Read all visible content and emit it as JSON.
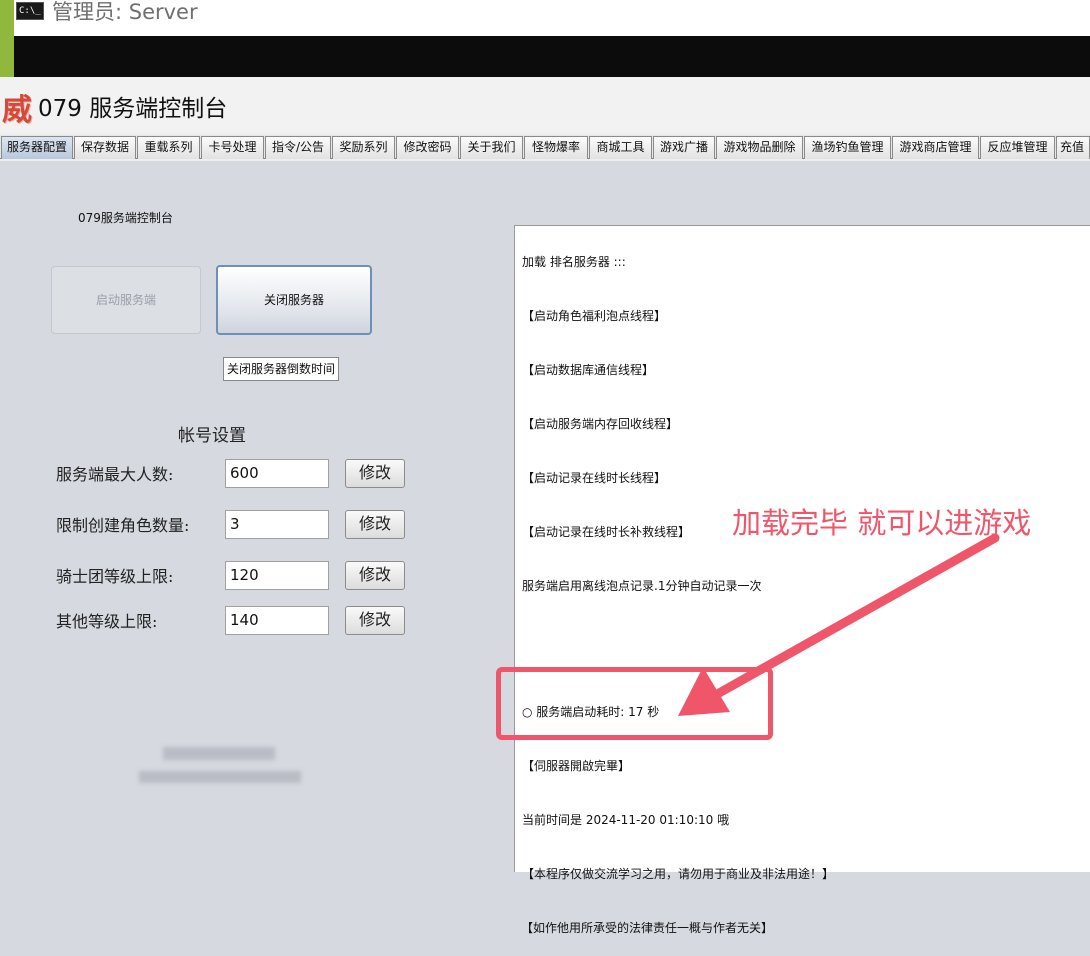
{
  "console": {
    "icon_text": "C:\\_",
    "title": "管理员:  Server"
  },
  "app": {
    "logo": "威",
    "title": "079 服务端控制台"
  },
  "tabs": [
    {
      "label": "服务器配置",
      "active": true
    },
    {
      "label": "保存数据"
    },
    {
      "label": "重载系列"
    },
    {
      "label": "卡号处理"
    },
    {
      "label": "指令/公告"
    },
    {
      "label": "奖励系列"
    },
    {
      "label": "修改密码"
    },
    {
      "label": "关于我们"
    },
    {
      "label": "怪物爆率"
    },
    {
      "label": "商城工具"
    },
    {
      "label": "游戏广播"
    },
    {
      "label": "游戏物品删除"
    },
    {
      "label": "渔场钓鱼管理"
    },
    {
      "label": "游戏商店管理"
    },
    {
      "label": "反应堆管理"
    },
    {
      "label": "充值"
    }
  ],
  "left": {
    "server_label": "079服务端控制台",
    "start_button": "启动服务端",
    "stop_button": "关闭服务器",
    "countdown_value": "关闭服务器倒数时间",
    "account_heading": "帐号设置",
    "fields": [
      {
        "label": "服务端最大人数:",
        "value": "600",
        "button": "修改"
      },
      {
        "label": "限制创建角色数量:",
        "value": "3",
        "button": "修改"
      },
      {
        "label": "骑士团等级上限:",
        "value": "120",
        "button": "修改"
      },
      {
        "label": "其他等级上限:",
        "value": "140",
        "button": "修改"
      }
    ]
  },
  "log": [
    "加载 排名服务器 :::",
    "【启动角色福利泡点线程】",
    "【启动数据库通信线程】",
    "【启动服务端内存回收线程】",
    "【启动记录在线时长线程】",
    "【启动记录在线时长补救线程】",
    "服务端启用离线泡点记录.1分钟自动记录一次",
    "",
    "○ 服务端启动耗时: 17 秒",
    "【伺服器開啟完畢】",
    "当前时间是 2024-11-20 01:10:10 哦",
    "【本程序仅做交流学习之用，请勿用于商业及非法用途！】",
    "【如作他用所承受的法律责任一概与作者无关】"
  ],
  "annotation": {
    "text": "加载完毕 就可以进游戏",
    "color": "#f0566a"
  }
}
